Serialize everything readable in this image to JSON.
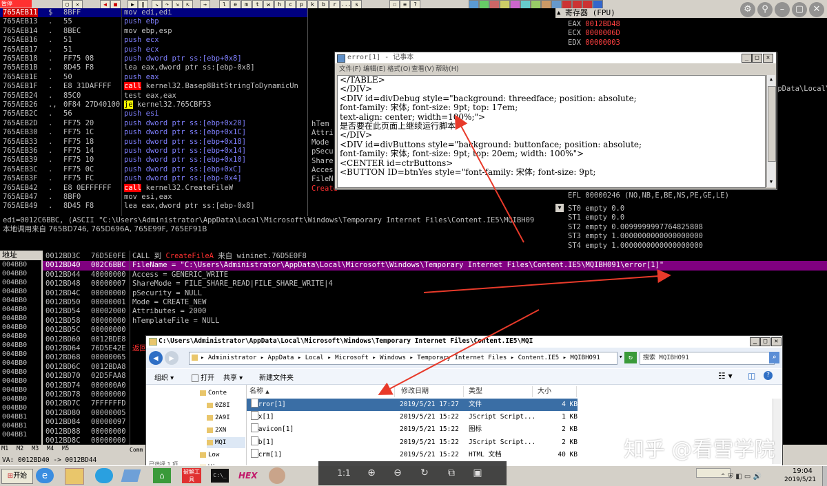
{
  "toolbar": {
    "left_label": "暂停",
    "letters": [
      "l",
      "e",
      "m",
      "t",
      "w",
      "h",
      "c",
      "p",
      "k",
      "b",
      "r",
      "...",
      "s"
    ]
  },
  "disasm": {
    "rows": [
      {
        "addr": "765AEB11",
        "mark": "$",
        "bytes": "8BFF",
        "asm": "mov edi,edi",
        "kind": "sel"
      },
      {
        "addr": "765AEB13",
        "mark": ".",
        "bytes": "55",
        "asm": "push ebp",
        "kind": "push"
      },
      {
        "addr": "765AEB14",
        "mark": ".",
        "bytes": "8BEC",
        "asm": "mov ebp,esp",
        "kind": ""
      },
      {
        "addr": "765AEB16",
        "mark": ".",
        "bytes": "51",
        "asm": "push ecx",
        "kind": "push"
      },
      {
        "addr": "765AEB17",
        "mark": ".",
        "bytes": "51",
        "asm": "push ecx",
        "kind": "push"
      },
      {
        "addr": "765AEB18",
        "mark": ".",
        "bytes": "FF75 08",
        "asm": "push dword ptr ss:[ebp+0x8]",
        "kind": "push"
      },
      {
        "addr": "765AEB1B",
        "mark": ".",
        "bytes": "8D45 F8",
        "asm": "lea eax,dword ptr ss:[ebp-0x8]",
        "kind": ""
      },
      {
        "addr": "765AEB1E",
        "mark": ".",
        "bytes": "50",
        "asm": "push eax",
        "kind": "push"
      },
      {
        "addr": "765AEB1F",
        "mark": ".",
        "bytes": "E8 31DAFFFF",
        "asm": "call kernel32.Basep8BitStringToDynamicUn",
        "kind": "call"
      },
      {
        "addr": "765AEB24",
        "mark": ".",
        "bytes": "85C0",
        "asm": "test eax,eax",
        "kind": ""
      },
      {
        "addr": "765AEB26",
        "mark": ".,",
        "bytes": "0F84 27D40100",
        "asm": "je kernel32.765CBF53",
        "kind": "je"
      },
      {
        "addr": "765AEB2C",
        "mark": ".",
        "bytes": "56",
        "asm": "push esi",
        "kind": "push"
      },
      {
        "addr": "765AEB2D",
        "mark": ".",
        "bytes": "FF75 20",
        "asm": "push dword ptr ss:[ebp+0x20]",
        "kind": "push"
      },
      {
        "addr": "765AEB30",
        "mark": ".",
        "bytes": "FF75 1C",
        "asm": "push dword ptr ss:[ebp+0x1C]",
        "kind": "push"
      },
      {
        "addr": "765AEB33",
        "mark": ".",
        "bytes": "FF75 18",
        "asm": "push dword ptr ss:[ebp+0x18]",
        "kind": "push"
      },
      {
        "addr": "765AEB36",
        "mark": ".",
        "bytes": "FF75 14",
        "asm": "push dword ptr ss:[ebp+0x14]",
        "kind": "push"
      },
      {
        "addr": "765AEB39",
        "mark": ".",
        "bytes": "FF75 10",
        "asm": "push dword ptr ss:[ebp+0x10]",
        "kind": "push"
      },
      {
        "addr": "765AEB3C",
        "mark": ".",
        "bytes": "FF75 0C",
        "asm": "push dword ptr ss:[ebp+0xC]",
        "kind": "push"
      },
      {
        "addr": "765AEB3F",
        "mark": ".",
        "bytes": "FF75 FC",
        "asm": "push dword ptr ss:[ebp-0x4]",
        "kind": "push"
      },
      {
        "addr": "765AEB42",
        "mark": ".",
        "bytes": "E8 0EFFFFFF",
        "asm": "call kernel32.CreateFileW",
        "kind": "call"
      },
      {
        "addr": "765AEB47",
        "mark": ".",
        "bytes": "8BF0",
        "asm": "mov esi,eax",
        "kind": ""
      },
      {
        "addr": "765AEB49",
        "mark": ".",
        "bytes": "8D45 F8",
        "asm": "lea eax,dword ptr ss:[ebp-0x8]",
        "kind": ""
      }
    ],
    "side_labels": [
      "hTem",
      "Attri",
      "Mode",
      "pSecu",
      "Share",
      "Acces",
      "FileN",
      "Create"
    ]
  },
  "registers": {
    "title": "寄存器 (FPU)",
    "regs": [
      {
        "name": "EAX",
        "value": "0012BD48"
      },
      {
        "name": "ECX",
        "value": "0000006D"
      },
      {
        "name": "EDX",
        "value": "00000003"
      }
    ],
    "partial_right": "ppData\\Local\\",
    "efl": "EFL 00000246 (NO,NB,E,BE,NS,PE,GE,LE)",
    "fpu": [
      "ST0 empty 0.0",
      "ST1 empty 0.0",
      "ST2 empty 0.0099999997764825808",
      "ST3 empty 1.0000000000000000000",
      "ST4 empty 1.0000000000000000000"
    ]
  },
  "info": {
    "line1": "edi=0012C6BBC, (ASCII \"C:\\Users\\Administrator\\AppData\\Local\\Microsoft\\Windows\\Temporary Internet Files\\Content.IE5\\MQIBH09",
    "line2": "本地调用来自 765BD746, 765D696A, 765E99F, 765EF91B"
  },
  "dump": {
    "header": "地址",
    "rows": [
      "004BB0",
      "004BB0",
      "004BB0",
      "004BB0",
      "004BB0",
      "004BB0",
      "004BB0",
      "004BB0",
      "004BB0",
      "004BB0",
      "004BB0",
      "004BB0",
      "004BB0",
      "004BB0",
      "004BB0",
      "004BB0",
      "004BB0",
      "004BB1",
      "004BB1",
      "004BB1"
    ],
    "tabs": [
      "M1",
      "M2",
      "M3",
      "M4",
      "M5"
    ],
    "status": "VA: 0012BD40 -> 0012BD44",
    "comm": "Comm"
  },
  "stack": {
    "rows": [
      {
        "addr": "0012BD3C",
        "val": "76D5E0FE",
        "text": "CALL 到 CreateFileA 来自 wininet.76D5E0F8",
        "sel": false
      },
      {
        "addr": "0012BD40",
        "val": "002C6BBC",
        "text": "FileName = \"C:\\Users\\Administrator\\AppData\\Local\\Microsoft\\Windows\\Temporary Internet Files\\Content.IE5\\MQIBH091\\error[1]\"",
        "sel": true
      },
      {
        "addr": "0012BD44",
        "val": "40000000",
        "text": "Access = GENERIC_WRITE",
        "sel": false
      },
      {
        "addr": "0012BD48",
        "val": "00000007",
        "text": "ShareMode = FILE_SHARE_READ|FILE_SHARE_WRITE|4",
        "sel": false
      },
      {
        "addr": "0012BD4C",
        "val": "00000000",
        "text": "pSecurity = NULL",
        "sel": false
      },
      {
        "addr": "0012BD50",
        "val": "00000001",
        "text": "Mode = CREATE_NEW",
        "sel": false
      },
      {
        "addr": "0012BD54",
        "val": "00002000",
        "text": "Attributes = 2000",
        "sel": false
      },
      {
        "addr": "0012BD58",
        "val": "00000000",
        "text": "hTemplateFile = NULL",
        "sel": false
      },
      {
        "addr": "0012BD5C",
        "val": "00000000",
        "text": "",
        "sel": false
      },
      {
        "addr": "0012BD60",
        "val": "0012BDE8",
        "text": "",
        "sel": false
      },
      {
        "addr": "0012BD64",
        "val": "76D5E42E",
        "text": "返回",
        "sel": false
      },
      {
        "addr": "0012BD68",
        "val": "00000065",
        "text": "",
        "sel": false
      },
      {
        "addr": "0012BD6C",
        "val": "0012BDA8",
        "text": "",
        "sel": false
      },
      {
        "addr": "0012BD70",
        "val": "02D5FAA8",
        "text": "",
        "sel": false
      },
      {
        "addr": "0012BD74",
        "val": "000000A0",
        "text": "",
        "sel": false
      },
      {
        "addr": "0012BD78",
        "val": "00000000",
        "text": "",
        "sel": false
      },
      {
        "addr": "0012BD7C",
        "val": "7FFFFFFD",
        "text": "",
        "sel": false
      },
      {
        "addr": "0012BD80",
        "val": "00000005",
        "text": "",
        "sel": false
      },
      {
        "addr": "0012BD84",
        "val": "00000097",
        "text": "",
        "sel": false
      },
      {
        "addr": "0012BD88",
        "val": "00000000",
        "text": "",
        "sel": false
      },
      {
        "addr": "0012BD8C",
        "val": "00000000",
        "text": "",
        "sel": false
      }
    ]
  },
  "notepad": {
    "title": "error[1] - 记事本",
    "menu": [
      "文件(F)",
      "编辑(E)",
      "格式(O)",
      "查看(V)",
      "帮助(H)"
    ],
    "lines": [
      "</TABLE>",
      "</DIV>",
      "<DIV id=divDebug style=\"background: threedface; position: absolute;",
      "font-family: 宋体; font-size: 9pt; top: 17em;",
      "text-align: center; width=100%;\">",
      "是否要在此页面上继续运行脚本?",
      "</DIV>",
      "<DIV id=divButtons style=\"background: buttonface; position: absolute;",
      "font-family: 宋体; font-size: 9pt; top: 20em; width: 100%\">",
      "<CENTER id=ctrButtons>",
      "<BUTTON ID=btnYes style=\"font-family: 宋体; font-size: 9pt;"
    ]
  },
  "explorer": {
    "title": "C:\\Users\\Administrator\\AppData\\Local\\Microsoft\\Windows\\Temporary Internet Files\\Content.IE5\\MQI",
    "breadcrumb": "▸ Administrator ▸ AppData ▸ Local ▸ Microsoft ▸ Windows ▸ Temporary Internet Files ▸ Content.IE5 ▸ MQIBH091",
    "search_placeholder": "搜索 MQIBH091",
    "commands": [
      "组织 ▾",
      "打开",
      "共享 ▾",
      "新建文件夹"
    ],
    "nav_items": [
      "Conte",
      "0Z8I",
      "2A9I",
      "2XN",
      "MQI",
      "Low",
      "Vi"
    ],
    "columns": [
      "名称",
      "修改日期",
      "类型",
      "大小"
    ],
    "files": [
      {
        "name": "error[1]",
        "date": "2019/5/21 17:27",
        "type": "文件",
        "size": "4 KB",
        "sel": true
      },
      {
        "name": "ex[1]",
        "date": "2019/5/21 15:22",
        "type": "JScript Script...",
        "size": "1 KB",
        "sel": false
      },
      {
        "name": "favicon[1]",
        "date": "2019/5/21 15:22",
        "type": "图标",
        "size": "2 KB",
        "sel": false
      },
      {
        "name": "fb[1]",
        "date": "2019/5/21 15:22",
        "type": "JScript Script...",
        "size": "2 KB",
        "sel": false
      },
      {
        "name": "hcrm[1]",
        "date": "2019/5/21 15:22",
        "type": "HTML 文档",
        "size": "40 KB",
        "sel": false
      }
    ],
    "status": "已选择 1 项"
  },
  "viewer_bar": {
    "ratio": "1:1"
  },
  "watermark": "知乎 @看雪学院",
  "taskbar": {
    "start": "开始",
    "hex": "HEX",
    "time": "19:04",
    "date": "2019/5/21",
    "red_app": "破解工具"
  },
  "colors": {
    "arrow": "#e83a2a",
    "push": "#8080ff",
    "call": "#ff0000",
    "select_purple": "#800080"
  }
}
